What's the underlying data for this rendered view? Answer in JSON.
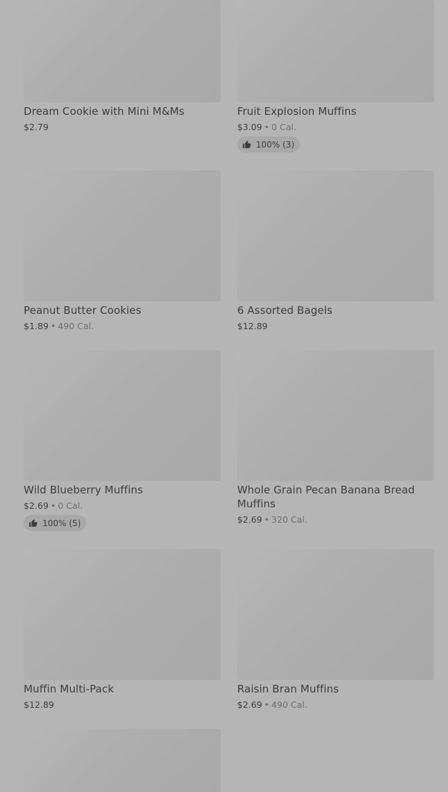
{
  "items": [
    {
      "name": "Dream Cookie with Mini M&Ms",
      "price": "$2.79",
      "calories": "",
      "rating": ""
    },
    {
      "name": "Fruit Explosion Muffins",
      "price": "$3.09",
      "calories": "0 Cal.",
      "rating": "100% (3)"
    },
    {
      "name": "Peanut Butter Cookies",
      "price": "$1.89",
      "calories": "490 Cal.",
      "rating": ""
    },
    {
      "name": "6 Assorted Bagels",
      "price": "$12.89",
      "calories": "",
      "rating": ""
    },
    {
      "name": "Wild Blueberry Muffins",
      "price": "$2.69",
      "calories": "0 Cal.",
      "rating": "100% (5)"
    },
    {
      "name": "Whole Grain Pecan Banana Bread Muffins",
      "price": "$2.69",
      "calories": "320 Cal.",
      "rating": ""
    },
    {
      "name": "Muffin Multi-Pack",
      "price": "$12.89",
      "calories": "",
      "rating": ""
    },
    {
      "name": "Raisin Bran Muffins",
      "price": "$2.69",
      "calories": "490 Cal.",
      "rating": ""
    },
    {
      "name": "",
      "price": "",
      "calories": "",
      "rating": ""
    }
  ],
  "separator": "•",
  "icons": {
    "rating": "thumbs-up-icon",
    "image": "product-image-placeholder"
  },
  "colors": {
    "overlay": "#b5b5b5",
    "text": "#3d3d3d",
    "muted": "#6e6e6e",
    "chip": "#a8a8a8"
  }
}
